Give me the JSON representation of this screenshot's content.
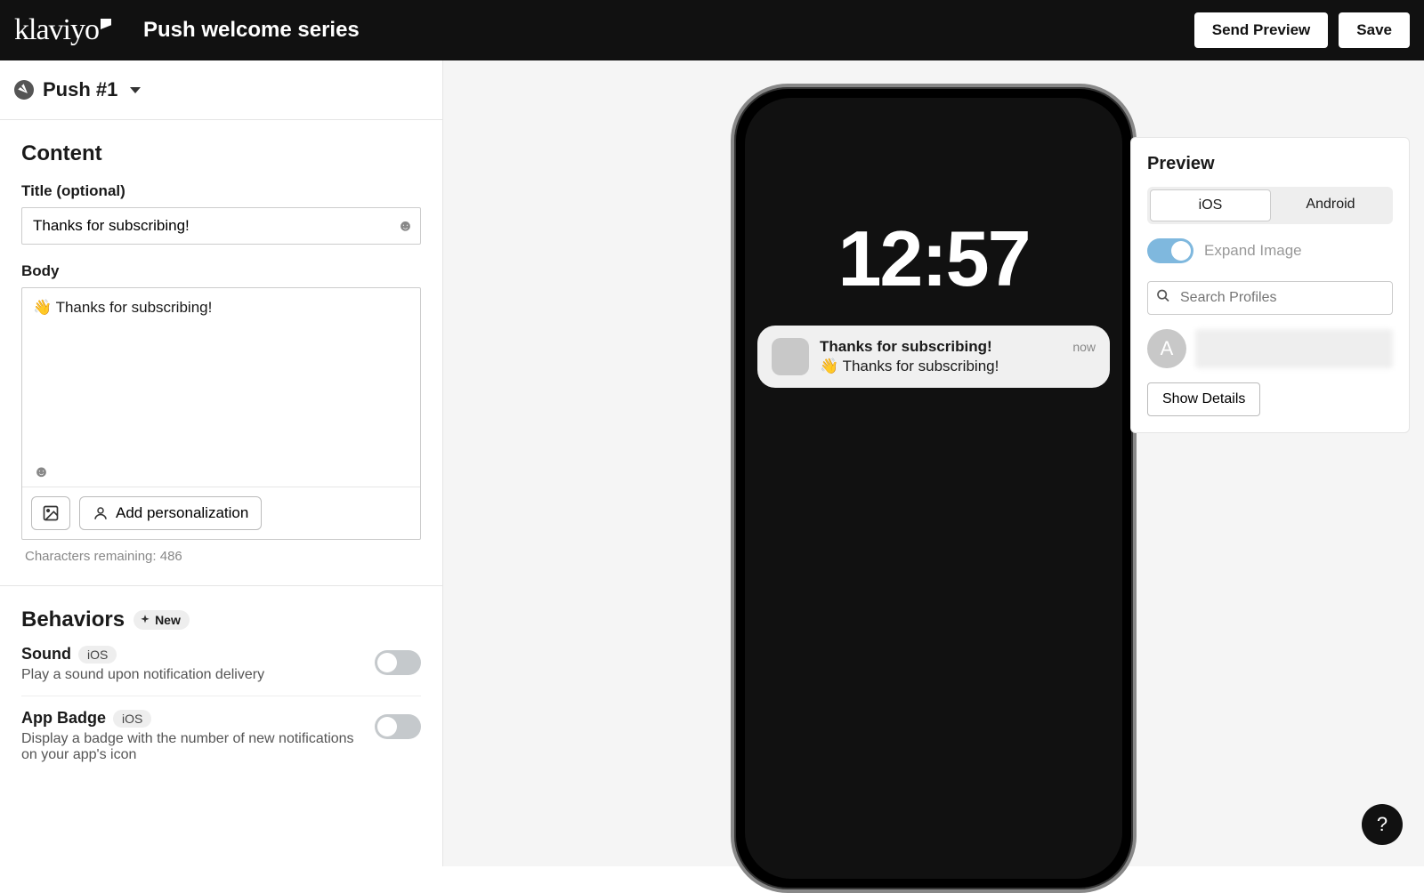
{
  "header": {
    "logo_text": "klaviyo",
    "title": "Push welcome series",
    "send_preview": "Send Preview",
    "save": "Save"
  },
  "push": {
    "name": "Push #1"
  },
  "content": {
    "heading": "Content",
    "title_label": "Title (optional)",
    "title_value": "Thanks for subscribing!",
    "body_label": "Body",
    "body_value": "👋 Thanks for subscribing!",
    "add_personalization": "Add personalization",
    "chars_remaining": "Characters remaining: 486"
  },
  "behaviors": {
    "heading": "Behaviors",
    "new_badge": "New",
    "items": [
      {
        "title": "Sound",
        "platform": "iOS",
        "desc": "Play a sound upon notification delivery",
        "on": false
      },
      {
        "title": "App Badge",
        "platform": "iOS",
        "desc": "Display a badge with the number of new notifications on your app's icon",
        "on": false
      }
    ]
  },
  "phone": {
    "time": "12:57",
    "notif_title": "Thanks for subscribing!",
    "notif_body": "👋 Thanks for subscribing!",
    "notif_time": "now"
  },
  "preview": {
    "heading": "Preview",
    "tabs": {
      "ios": "iOS",
      "android": "Android"
    },
    "expand_on": true,
    "expand_label": "Expand Image",
    "search_placeholder": "Search Profiles",
    "avatar_initial": "A",
    "show_details": "Show Details"
  },
  "help": "?"
}
